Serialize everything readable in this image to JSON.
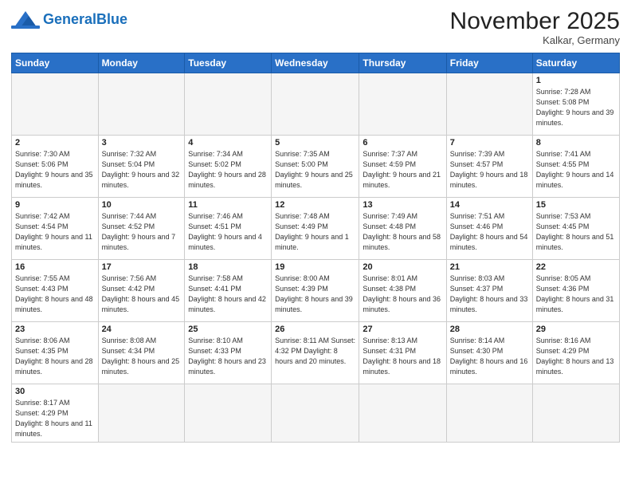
{
  "header": {
    "logo_general": "General",
    "logo_blue": "Blue",
    "month_title": "November 2025",
    "location": "Kalkar, Germany"
  },
  "weekdays": [
    "Sunday",
    "Monday",
    "Tuesday",
    "Wednesday",
    "Thursday",
    "Friday",
    "Saturday"
  ],
  "weeks": [
    [
      {
        "day": "",
        "info": "",
        "empty": true
      },
      {
        "day": "",
        "info": "",
        "empty": true
      },
      {
        "day": "",
        "info": "",
        "empty": true
      },
      {
        "day": "",
        "info": "",
        "empty": true
      },
      {
        "day": "",
        "info": "",
        "empty": true
      },
      {
        "day": "",
        "info": "",
        "empty": true
      },
      {
        "day": "1",
        "info": "Sunrise: 7:28 AM\nSunset: 5:08 PM\nDaylight: 9 hours\nand 39 minutes."
      }
    ],
    [
      {
        "day": "2",
        "info": "Sunrise: 7:30 AM\nSunset: 5:06 PM\nDaylight: 9 hours\nand 35 minutes."
      },
      {
        "day": "3",
        "info": "Sunrise: 7:32 AM\nSunset: 5:04 PM\nDaylight: 9 hours\nand 32 minutes."
      },
      {
        "day": "4",
        "info": "Sunrise: 7:34 AM\nSunset: 5:02 PM\nDaylight: 9 hours\nand 28 minutes."
      },
      {
        "day": "5",
        "info": "Sunrise: 7:35 AM\nSunset: 5:00 PM\nDaylight: 9 hours\nand 25 minutes."
      },
      {
        "day": "6",
        "info": "Sunrise: 7:37 AM\nSunset: 4:59 PM\nDaylight: 9 hours\nand 21 minutes."
      },
      {
        "day": "7",
        "info": "Sunrise: 7:39 AM\nSunset: 4:57 PM\nDaylight: 9 hours\nand 18 minutes."
      },
      {
        "day": "8",
        "info": "Sunrise: 7:41 AM\nSunset: 4:55 PM\nDaylight: 9 hours\nand 14 minutes."
      }
    ],
    [
      {
        "day": "9",
        "info": "Sunrise: 7:42 AM\nSunset: 4:54 PM\nDaylight: 9 hours\nand 11 minutes."
      },
      {
        "day": "10",
        "info": "Sunrise: 7:44 AM\nSunset: 4:52 PM\nDaylight: 9 hours\nand 7 minutes."
      },
      {
        "day": "11",
        "info": "Sunrise: 7:46 AM\nSunset: 4:51 PM\nDaylight: 9 hours\nand 4 minutes."
      },
      {
        "day": "12",
        "info": "Sunrise: 7:48 AM\nSunset: 4:49 PM\nDaylight: 9 hours\nand 1 minute."
      },
      {
        "day": "13",
        "info": "Sunrise: 7:49 AM\nSunset: 4:48 PM\nDaylight: 8 hours\nand 58 minutes."
      },
      {
        "day": "14",
        "info": "Sunrise: 7:51 AM\nSunset: 4:46 PM\nDaylight: 8 hours\nand 54 minutes."
      },
      {
        "day": "15",
        "info": "Sunrise: 7:53 AM\nSunset: 4:45 PM\nDaylight: 8 hours\nand 51 minutes."
      }
    ],
    [
      {
        "day": "16",
        "info": "Sunrise: 7:55 AM\nSunset: 4:43 PM\nDaylight: 8 hours\nand 48 minutes."
      },
      {
        "day": "17",
        "info": "Sunrise: 7:56 AM\nSunset: 4:42 PM\nDaylight: 8 hours\nand 45 minutes."
      },
      {
        "day": "18",
        "info": "Sunrise: 7:58 AM\nSunset: 4:41 PM\nDaylight: 8 hours\nand 42 minutes."
      },
      {
        "day": "19",
        "info": "Sunrise: 8:00 AM\nSunset: 4:39 PM\nDaylight: 8 hours\nand 39 minutes."
      },
      {
        "day": "20",
        "info": "Sunrise: 8:01 AM\nSunset: 4:38 PM\nDaylight: 8 hours\nand 36 minutes."
      },
      {
        "day": "21",
        "info": "Sunrise: 8:03 AM\nSunset: 4:37 PM\nDaylight: 8 hours\nand 33 minutes."
      },
      {
        "day": "22",
        "info": "Sunrise: 8:05 AM\nSunset: 4:36 PM\nDaylight: 8 hours\nand 31 minutes."
      }
    ],
    [
      {
        "day": "23",
        "info": "Sunrise: 8:06 AM\nSunset: 4:35 PM\nDaylight: 8 hours\nand 28 minutes."
      },
      {
        "day": "24",
        "info": "Sunrise: 8:08 AM\nSunset: 4:34 PM\nDaylight: 8 hours\nand 25 minutes."
      },
      {
        "day": "25",
        "info": "Sunrise: 8:10 AM\nSunset: 4:33 PM\nDaylight: 8 hours\nand 23 minutes."
      },
      {
        "day": "26",
        "info": "Sunrise: 8:11 AM\nSunset: 4:32 PM\nDaylight: 8 hours\nand 20 minutes."
      },
      {
        "day": "27",
        "info": "Sunrise: 8:13 AM\nSunset: 4:31 PM\nDaylight: 8 hours\nand 18 minutes."
      },
      {
        "day": "28",
        "info": "Sunrise: 8:14 AM\nSunset: 4:30 PM\nDaylight: 8 hours\nand 16 minutes."
      },
      {
        "day": "29",
        "info": "Sunrise: 8:16 AM\nSunset: 4:29 PM\nDaylight: 8 hours\nand 13 minutes."
      }
    ],
    [
      {
        "day": "30",
        "info": "Sunrise: 8:17 AM\nSunset: 4:29 PM\nDaylight: 8 hours\nand 11 minutes."
      },
      {
        "day": "",
        "info": "",
        "empty": true
      },
      {
        "day": "",
        "info": "",
        "empty": true
      },
      {
        "day": "",
        "info": "",
        "empty": true
      },
      {
        "day": "",
        "info": "",
        "empty": true
      },
      {
        "day": "",
        "info": "",
        "empty": true
      },
      {
        "day": "",
        "info": "",
        "empty": true
      }
    ]
  ]
}
